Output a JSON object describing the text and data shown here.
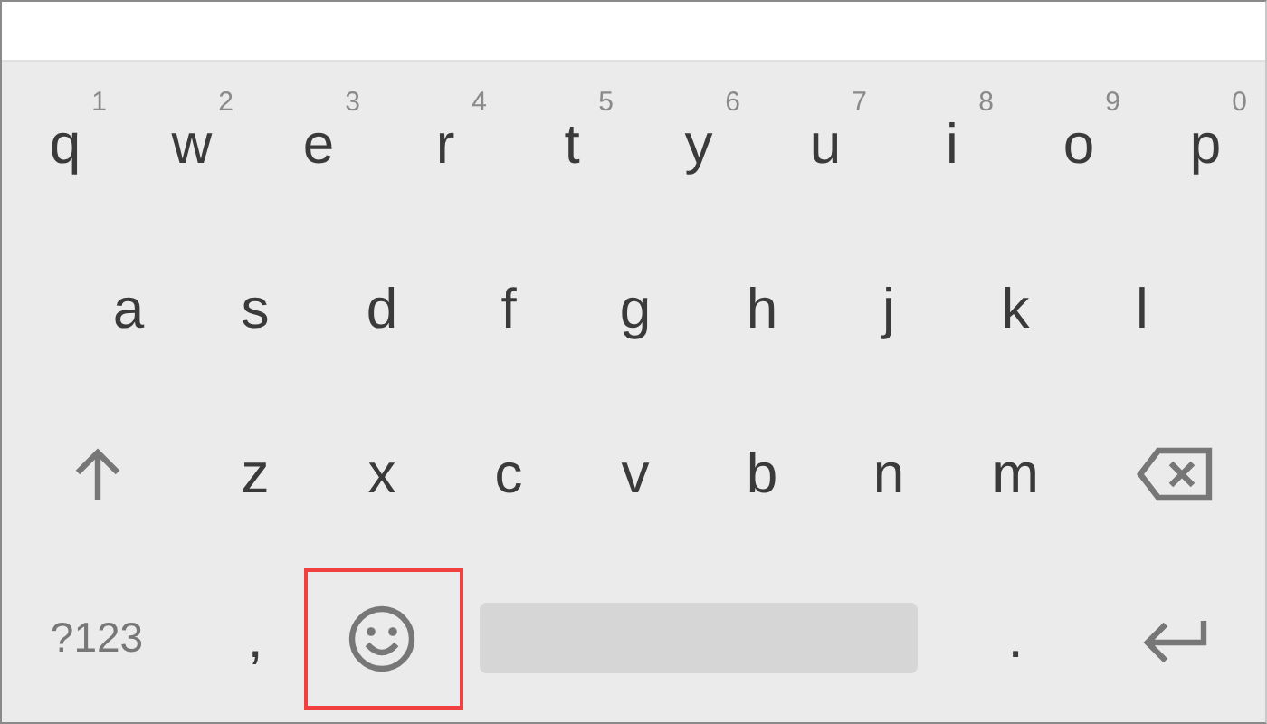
{
  "keyboard": {
    "rows": [
      {
        "keys": [
          {
            "kind": "letter",
            "label": "q",
            "hint": "1"
          },
          {
            "kind": "letter",
            "label": "w",
            "hint": "2"
          },
          {
            "kind": "letter",
            "label": "e",
            "hint": "3"
          },
          {
            "kind": "letter",
            "label": "r",
            "hint": "4"
          },
          {
            "kind": "letter",
            "label": "t",
            "hint": "5"
          },
          {
            "kind": "letter",
            "label": "y",
            "hint": "6"
          },
          {
            "kind": "letter",
            "label": "u",
            "hint": "7"
          },
          {
            "kind": "letter",
            "label": "i",
            "hint": "8"
          },
          {
            "kind": "letter",
            "label": "o",
            "hint": "9"
          },
          {
            "kind": "letter",
            "label": "p",
            "hint": "0"
          }
        ]
      },
      {
        "keys": [
          {
            "kind": "letter",
            "label": "a"
          },
          {
            "kind": "letter",
            "label": "s"
          },
          {
            "kind": "letter",
            "label": "d"
          },
          {
            "kind": "letter",
            "label": "f"
          },
          {
            "kind": "letter",
            "label": "g"
          },
          {
            "kind": "letter",
            "label": "h"
          },
          {
            "kind": "letter",
            "label": "j"
          },
          {
            "kind": "letter",
            "label": "k"
          },
          {
            "kind": "letter",
            "label": "l"
          }
        ]
      },
      {
        "keys": [
          {
            "kind": "shift"
          },
          {
            "kind": "letter",
            "label": "z"
          },
          {
            "kind": "letter",
            "label": "x"
          },
          {
            "kind": "letter",
            "label": "c"
          },
          {
            "kind": "letter",
            "label": "v"
          },
          {
            "kind": "letter",
            "label": "b"
          },
          {
            "kind": "letter",
            "label": "n"
          },
          {
            "kind": "letter",
            "label": "m"
          },
          {
            "kind": "backspace"
          }
        ]
      },
      {
        "keys": [
          {
            "kind": "symbols",
            "label": "?123"
          },
          {
            "kind": "letter",
            "label": ","
          },
          {
            "kind": "emoji",
            "highlighted": true
          },
          {
            "kind": "space"
          },
          {
            "kind": "letter",
            "label": "."
          },
          {
            "kind": "enter"
          }
        ]
      }
    ]
  }
}
